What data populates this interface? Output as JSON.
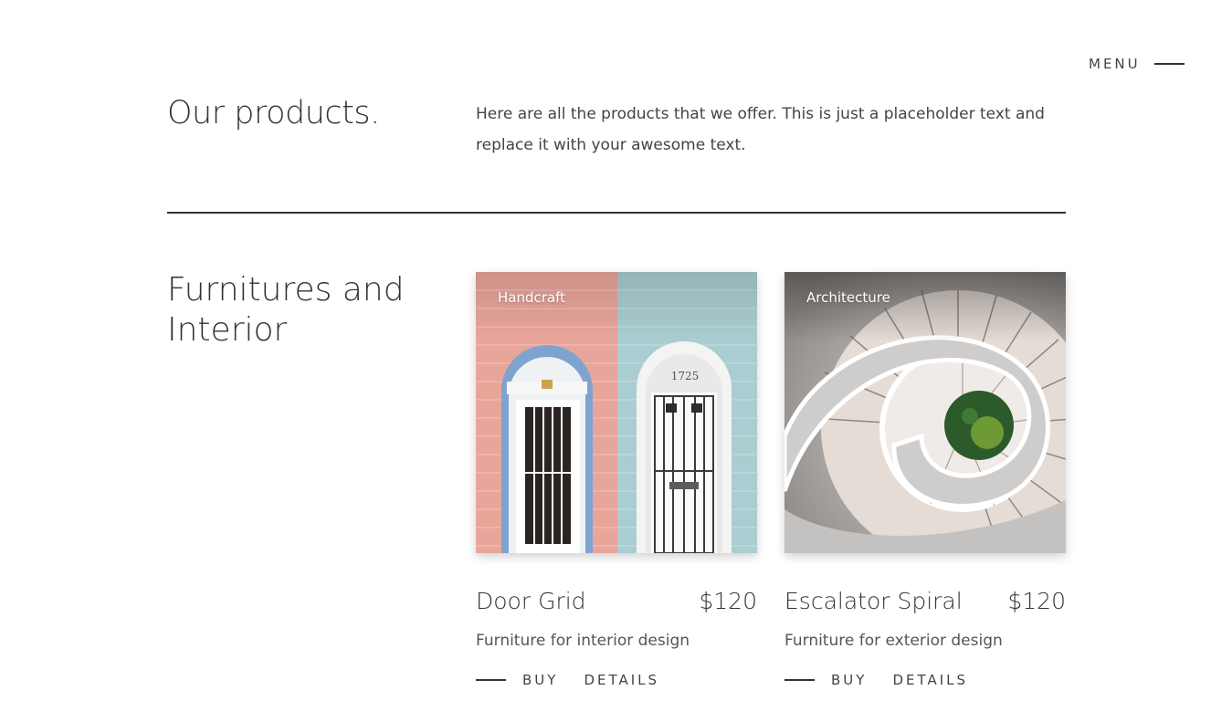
{
  "menu": {
    "label": "MENU"
  },
  "header": {
    "title": "Our products.",
    "intro": "Here are all the products that we offer. This is just a placeholder text and replace it with your awesome text."
  },
  "category": {
    "title": "Furnitures and Interior"
  },
  "products": [
    {
      "tag": "Handcraft",
      "name": "Door Grid",
      "price": "$120",
      "description": "Furniture for interior design",
      "door_number": "1725",
      "buy_label": "BUY",
      "details_label": "DETAILS"
    },
    {
      "tag": "Architecture",
      "name": "Escalator Spiral",
      "price": "$120",
      "description": "Furniture for exterior design",
      "buy_label": "BUY",
      "details_label": "DETAILS"
    }
  ],
  "colors": {
    "text": "#333333",
    "brick_pink": "#e8a59a",
    "brick_blue": "#a9cdd1",
    "door_arch_blue": "#7ea3cf",
    "stair_grey": "#c9c8c7"
  }
}
